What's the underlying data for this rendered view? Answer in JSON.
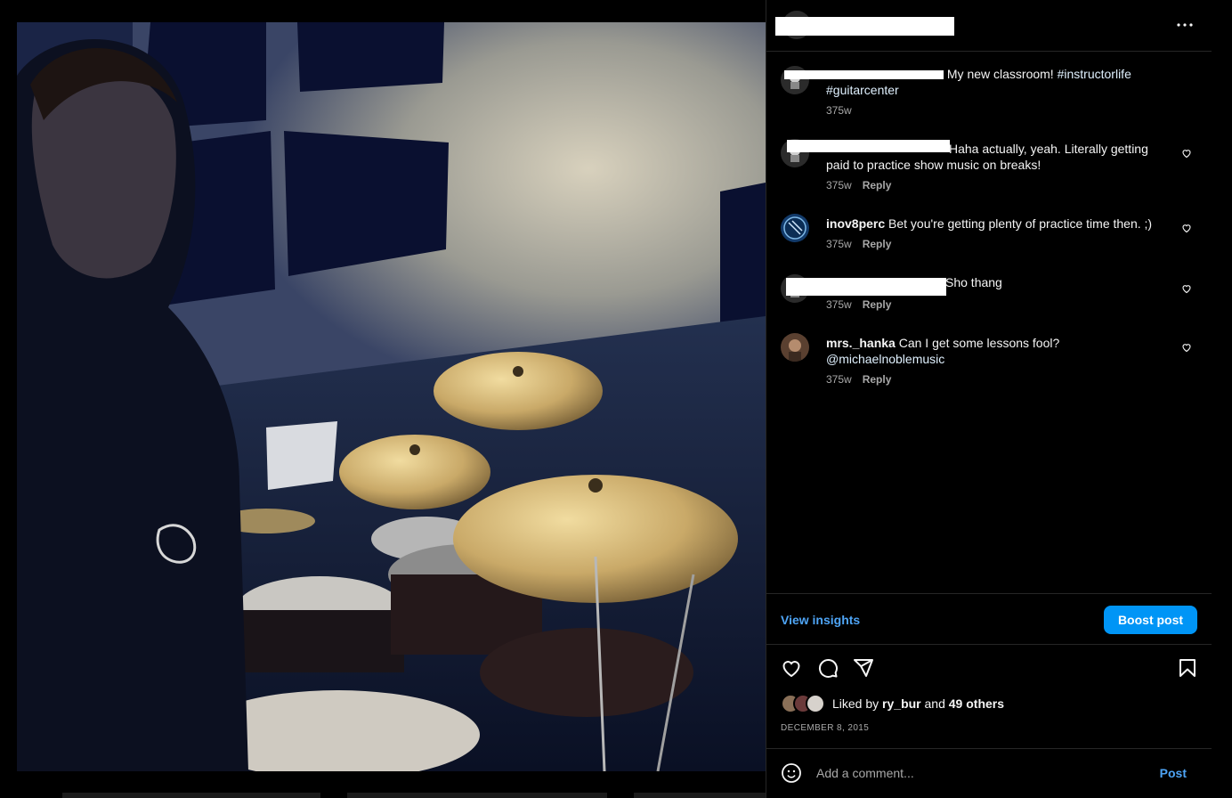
{
  "post": {
    "image_alt": "Selfie in a drum practice room with Sabian cymbals"
  },
  "header": {
    "more_icon": "more-horizontal-icon"
  },
  "caption": {
    "text": " My new classroom! ",
    "tag1": "#instructorlife",
    "tag2": "#guitarcenter",
    "time": "375w"
  },
  "comments": [
    {
      "user": "",
      "text": "Haha actually, yeah. Literally getting paid to practice show music on breaks!",
      "time": "375w",
      "reply": "Reply"
    },
    {
      "user": "inov8perc",
      "text": " Bet you're getting plenty of practice time then. ;)",
      "time": "375w",
      "reply": "Reply"
    },
    {
      "user": "",
      "text": "Sho thang",
      "time": "375w",
      "reply": "Reply"
    },
    {
      "user": "mrs._hanka",
      "text": " Can I get some lessons fool?",
      "mention": "@michaelnoblemusic",
      "time": "375w",
      "reply": "Reply"
    }
  ],
  "insights": {
    "view_label": "View insights",
    "boost_label": "Boost post"
  },
  "actions": {
    "icons": [
      "heart-icon",
      "comment-icon",
      "share-icon",
      "bookmark-icon"
    ]
  },
  "likes": {
    "prefix": "Liked by ",
    "user": "ry_bur",
    "middle": " and ",
    "others": "49 others"
  },
  "date": "DECEMBER 8, 2015",
  "add_comment": {
    "placeholder": "Add a comment...",
    "post_label": "Post"
  },
  "colors": {
    "accent": "#0095f6",
    "link": "#4ea4f5",
    "background": "#000000"
  }
}
